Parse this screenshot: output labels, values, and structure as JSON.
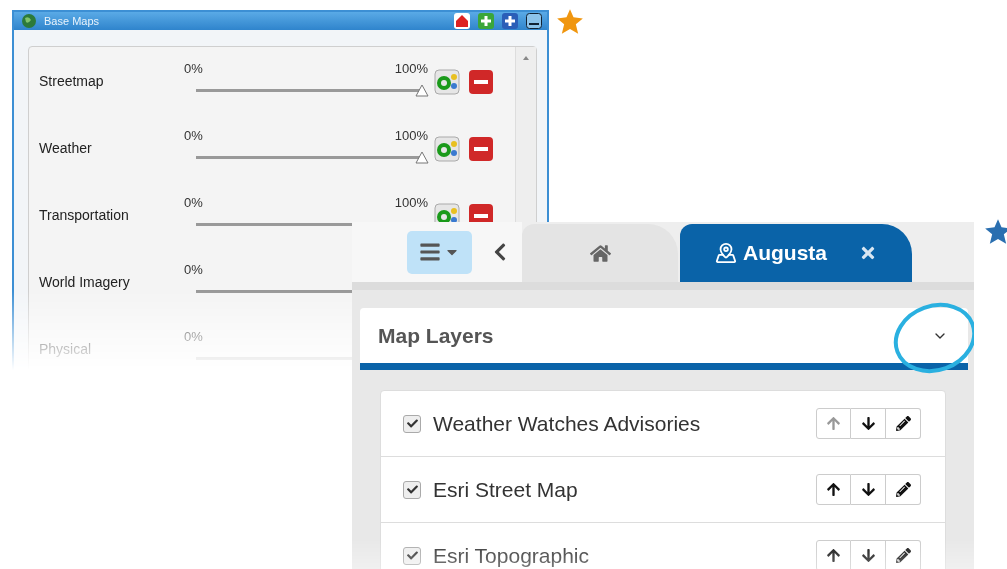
{
  "old_window": {
    "title": "Base Maps",
    "layers": [
      {
        "name": "Streetmap",
        "min_label": "0%",
        "max_label": "100%",
        "level": 1
      },
      {
        "name": "Weather",
        "min_label": "0%",
        "max_label": "100%",
        "level": 1
      },
      {
        "name": "Transportation",
        "min_label": "0%",
        "max_label": "100%"
      },
      {
        "name": "World Imagery",
        "min_label": "0%"
      },
      {
        "name": "Physical",
        "min_label": "0%"
      }
    ]
  },
  "new_window": {
    "tabs": [
      {
        "kind": "home",
        "selected": false
      },
      {
        "kind": "map",
        "label": "Augusta",
        "selected": true
      }
    ],
    "panel_title": "Map Layers",
    "layers": [
      {
        "name": "Weather Watches Advisories",
        "checked": true,
        "can_move_up": false
      },
      {
        "name": "Esri Street Map",
        "checked": true,
        "can_move_up": true
      },
      {
        "name": "Esri Topographic",
        "checked": true,
        "can_move_up": true
      }
    ]
  }
}
